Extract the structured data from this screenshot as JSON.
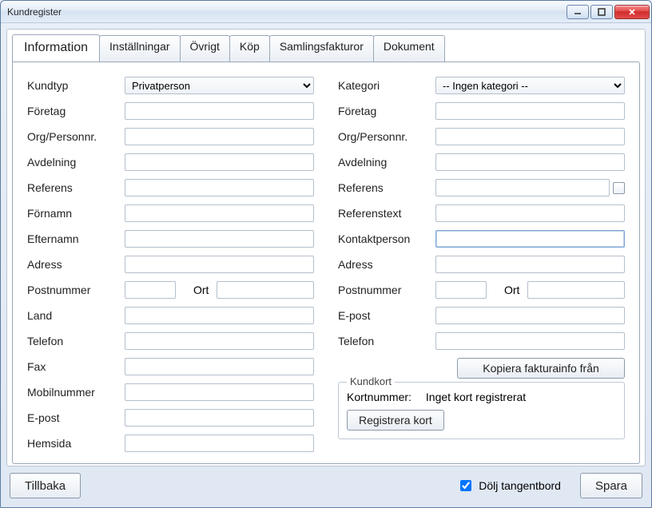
{
  "window": {
    "title": "Kundregister"
  },
  "tabs": {
    "information": "Information",
    "installningar": "Inställningar",
    "ovrigt": "Övrigt",
    "kop": "Köp",
    "samlingsfakturor": "Samlingsfakturor",
    "dokument": "Dokument"
  },
  "left": {
    "kundtyp_label": "Kundtyp",
    "kundtyp_value": "Privatperson",
    "foretag": "Företag",
    "orgpers": "Org/Personnr.",
    "avdelning": "Avdelning",
    "referens": "Referens",
    "fornamn": "Förnamn",
    "efternamn": "Efternamn",
    "adress": "Adress",
    "postnummer": "Postnummer",
    "ort": "Ort",
    "land": "Land",
    "telefon": "Telefon",
    "fax": "Fax",
    "mobil": "Mobilnummer",
    "epost": "E-post",
    "hemsida": "Hemsida"
  },
  "right": {
    "kategori_label": "Kategori",
    "kategori_value": "-- Ingen kategori --",
    "foretag": "Företag",
    "orgpers": "Org/Personnr.",
    "avdelning": "Avdelning",
    "referens": "Referens",
    "referenstext": "Referenstext",
    "kontaktperson": "Kontaktperson",
    "adress": "Adress",
    "postnummer": "Postnummer",
    "ort": "Ort",
    "epost": "E-post",
    "telefon": "Telefon",
    "kopiera_btn": "Kopiera fakturainfo från",
    "kundkort_legend": "Kundkort",
    "kortnummer_label": "Kortnummer:",
    "kortnummer_value": "Inget kort registrerat",
    "registrera_btn": "Registrera kort"
  },
  "bottom": {
    "tillbaka": "Tillbaka",
    "dolj": "Dölj tangentbord",
    "spara": "Spara"
  }
}
